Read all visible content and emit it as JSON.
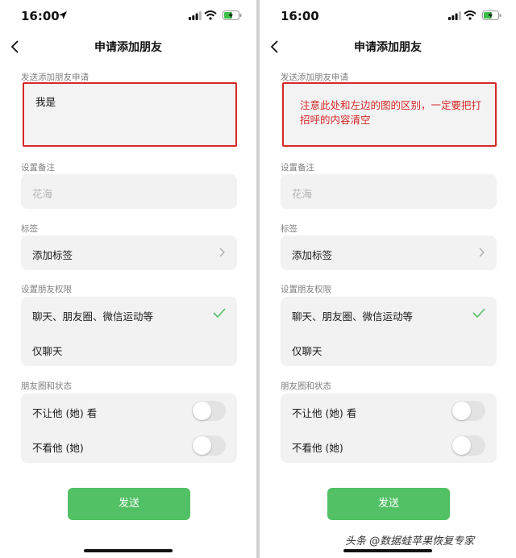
{
  "screens": [
    {
      "status": {
        "time": "16:00"
      },
      "nav": {
        "title": "申请添加朋友"
      },
      "greeting": {
        "label": "发送添加朋友申请",
        "value": "我是"
      },
      "remark": {
        "label": "设置备注",
        "placeholder": "花海"
      },
      "tags": {
        "label": "标签",
        "item": "添加标签"
      },
      "permissions": {
        "label": "设置朋友权限",
        "options": [
          "聊天、朋友圈、微信运动等",
          "仅聊天"
        ],
        "selected": "聊天、朋友圈、微信运动等"
      },
      "moments": {
        "label": "朋友圈和状态",
        "toggles": [
          {
            "label": "不让他 (她) 看",
            "on": false
          },
          {
            "label": "不看他 (她)",
            "on": false
          }
        ]
      },
      "send_label": "发送"
    },
    {
      "status": {
        "time": "16:00"
      },
      "nav": {
        "title": "申请添加朋友"
      },
      "greeting": {
        "label": "发送添加朋友申请",
        "value": "注意此处和左边的图的区别，一定要把打招呼的内容清空"
      },
      "remark": {
        "label": "设置备注",
        "placeholder": "花海"
      },
      "tags": {
        "label": "标签",
        "item": "添加标签"
      },
      "permissions": {
        "label": "设置朋友权限",
        "options": [
          "聊天、朋友圈、微信运动等",
          "仅聊天"
        ],
        "selected": "聊天、朋友圈、微信运动等"
      },
      "moments": {
        "label": "朋友圈和状态",
        "toggles": [
          {
            "label": "不让他 (她) 看",
            "on": false
          },
          {
            "label": "不看他 (她)",
            "on": false
          }
        ]
      },
      "send_label": "发送"
    }
  ],
  "watermark": "头条 @数据蛙苹果恢复专家",
  "colors": {
    "accent_green": "#52c064",
    "annotation_red": "#d62828",
    "check_green": "#52c064"
  }
}
